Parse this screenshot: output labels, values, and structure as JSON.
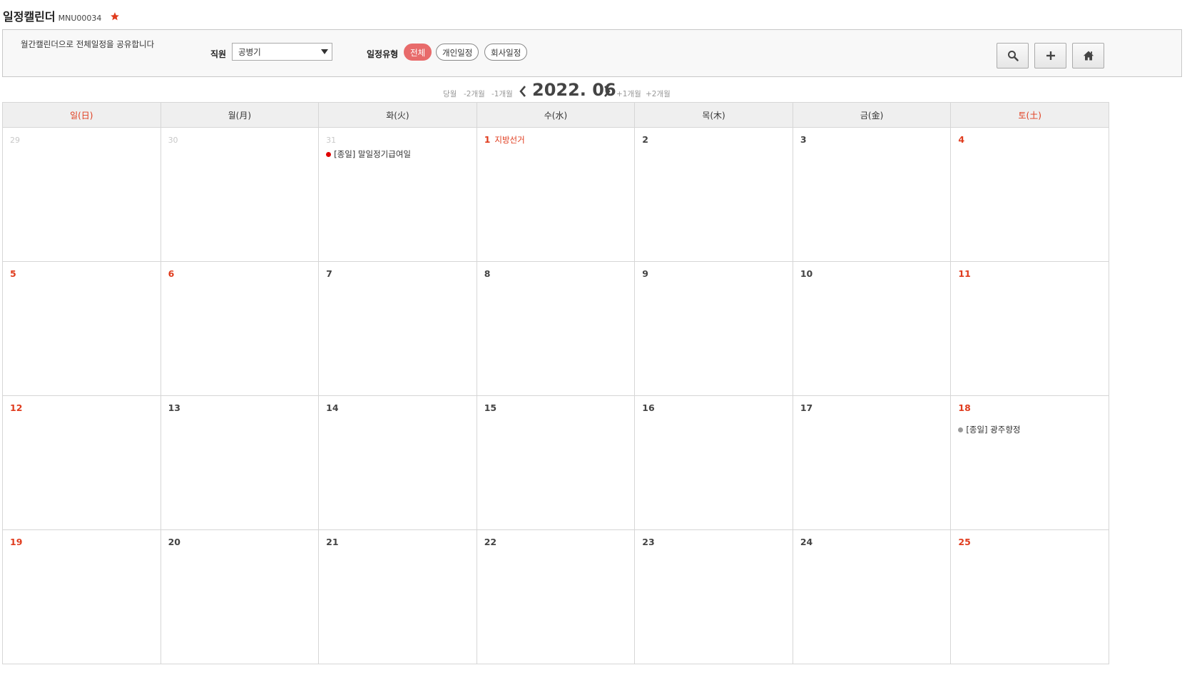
{
  "header": {
    "title": "일정캘린더",
    "menu_code": "MNU00034",
    "favorite_icon": "star-icon",
    "favorite_color": "#e03c1e"
  },
  "filter": {
    "description": "월간캘린더으로 전체일정을 공유합니다",
    "staff_label": "직원",
    "staff_value": "공병기",
    "type_label": "일정유형",
    "types": [
      "전체",
      "개인일정",
      "회사일정"
    ],
    "active_type": "전체",
    "active_color": "#e86b6b",
    "buttons": [
      "search-icon",
      "plus-icon",
      "home-icon"
    ]
  },
  "nav": {
    "current": "당월",
    "minus2": "-2개월",
    "minus1": "-1개월",
    "month_label": "2022. 06",
    "plus1": "+1개월",
    "plus2": "+2개월"
  },
  "weekdays": [
    "일(日)",
    "월(月)",
    "화(火)",
    "수(水)",
    "목(木)",
    "금(金)",
    "토(土)"
  ],
  "weeks": [
    [
      {
        "day": "29",
        "muted": true
      },
      {
        "day": "30",
        "muted": true
      },
      {
        "day": "31",
        "muted": true,
        "events": [
          {
            "text": "[종일] 말일정기급여일",
            "color": "#e00000"
          }
        ]
      },
      {
        "day": "1",
        "holiday": true,
        "holiday_name": "지방선거"
      },
      {
        "day": "2"
      },
      {
        "day": "3"
      },
      {
        "day": "4",
        "holiday": true
      }
    ],
    [
      {
        "day": "5",
        "holiday": true
      },
      {
        "day": "6",
        "holiday": true
      },
      {
        "day": "7"
      },
      {
        "day": "8"
      },
      {
        "day": "9"
      },
      {
        "day": "10"
      },
      {
        "day": "11",
        "holiday": true
      }
    ],
    [
      {
        "day": "12",
        "holiday": true
      },
      {
        "day": "13"
      },
      {
        "day": "14"
      },
      {
        "day": "15"
      },
      {
        "day": "16"
      },
      {
        "day": "17"
      },
      {
        "day": "18",
        "holiday": true,
        "events": [
          {
            "text": "[종일] 광주향정",
            "color": "#9a9a9a",
            "spaced": true
          }
        ]
      }
    ],
    [
      {
        "day": "19",
        "holiday": true
      },
      {
        "day": "20"
      },
      {
        "day": "21"
      },
      {
        "day": "22"
      },
      {
        "day": "23"
      },
      {
        "day": "24"
      },
      {
        "day": "25",
        "holiday": true
      }
    ]
  ]
}
